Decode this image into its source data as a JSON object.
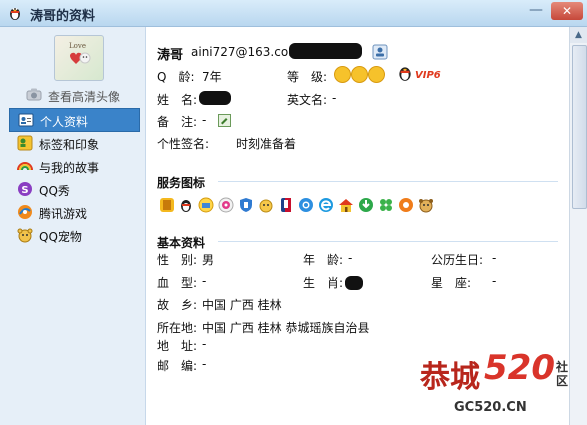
{
  "window": {
    "title": "涛哥的资料",
    "minimize_glyph": "—",
    "close_glyph": "✕"
  },
  "sidebar": {
    "view_hd_avatar": "查看高清头像",
    "avatar_text": "Love",
    "items": [
      {
        "label": "个人资料",
        "icon": "person-card-icon",
        "selected": true
      },
      {
        "label": "标签和印象",
        "icon": "tag-icon",
        "selected": false
      },
      {
        "label": "与我的故事",
        "icon": "rainbow-icon",
        "selected": false
      },
      {
        "label": "QQ秀",
        "icon": "qqshow-icon",
        "selected": false
      },
      {
        "label": "腾讯游戏",
        "icon": "game-icon",
        "selected": false
      },
      {
        "label": "QQ宠物",
        "icon": "pet-icon",
        "selected": false
      }
    ]
  },
  "profile": {
    "nickname": "涛哥",
    "email": "aini727@163.com",
    "age_label": "Q　龄:",
    "age_value": "7年",
    "level_label": "等　级:",
    "vip_badge": "VIP6",
    "name_label": "姓　名:",
    "english_name_label": "英文名:",
    "english_name_value": "-",
    "remark_label": "备　注:",
    "remark_value": "-",
    "signature_label": "个性签名:",
    "signature_value": "时刻准备着"
  },
  "services": {
    "title": "服务图标",
    "icons": [
      "qzone-icon",
      "penguin-icon",
      "mail-icon",
      "music-icon",
      "shield-icon",
      "pet-egg-icon",
      "nba-icon",
      "browser-icon",
      "ie-icon",
      "house-icon",
      "download-icon",
      "clover-icon",
      "game-center-icon",
      "dog-icon"
    ]
  },
  "basic": {
    "title": "基本资料",
    "gender_label": "性　别:",
    "gender_value": "男",
    "age_label": "年　龄:",
    "age_value": "-",
    "birthday_label": "公历生日:",
    "birthday_value": "-",
    "blood_label": "血　型:",
    "blood_value": "-",
    "zodiac_label": "生　肖:",
    "star_label": "星　座:",
    "star_value": "-",
    "hometown_label": "故　乡:",
    "hometown_value": "中国 广西 桂林",
    "location_label": "所在地:",
    "location_value": "中国 广西 桂林 恭城瑶族自治县",
    "address_label": "地　址:",
    "address_value": "-",
    "postcode_label": "邮　编:",
    "postcode_value": "-"
  },
  "watermark": {
    "brand": "恭城",
    "number": "520",
    "suffix": "社区",
    "domain": "GC520.CN"
  },
  "colors": {
    "selected_nav": "#3a83c9",
    "vip_red": "#e03a1e",
    "watermark_red": "#b8261c"
  }
}
